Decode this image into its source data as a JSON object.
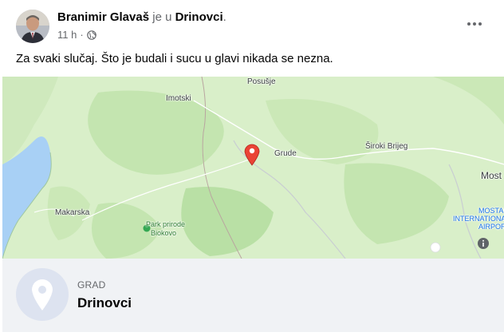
{
  "post": {
    "author": "Branimir Glavaš",
    "location_connector": "je u",
    "location": "Drinovci",
    "trailing": ".",
    "time": "11 h",
    "separator": "·",
    "text": "Za svaki slučaj. Što je budali i sucu u glavi nikada se nezna."
  },
  "map": {
    "labels": {
      "posusje": "Posušje",
      "imotski": "Imotski",
      "grude": "Grude",
      "siroki": "Široki Brijeg",
      "most": "Most",
      "makarska": "Makarska",
      "park1": "Park prirode",
      "park2": "Biokovo",
      "airport1": "MOSTAR",
      "airport2": "INTERNATIONAL",
      "airport3": "AIRPORT"
    },
    "colors": {
      "sea": "#a8d0f5",
      "land": "#d9efc9",
      "forest": "#b9e0a5",
      "pin": "#ea4335"
    }
  },
  "place": {
    "category": "GRAD",
    "name": "Drinovci"
  },
  "icons": {
    "more": "more-options-icon",
    "globe": "globe-icon",
    "pin": "map-pin-icon",
    "place": "location-pin-icon",
    "info": "info-icon"
  }
}
